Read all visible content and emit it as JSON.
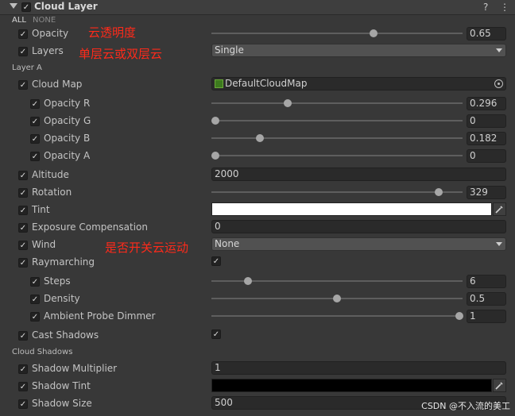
{
  "component": {
    "title": "Cloud Layer",
    "checked": true
  },
  "header_icons": {
    "help": "?",
    "settings": "⋮"
  },
  "filter": {
    "all": "ALL",
    "none": "NONE"
  },
  "properties": {
    "opacity": {
      "label": "Opacity",
      "value": "0.65",
      "slider": 0.65
    },
    "layers": {
      "label": "Layers",
      "value": "Single"
    },
    "layer_a_section": "Layer A",
    "cloud_map": {
      "label": "Cloud Map",
      "value": "DefaultCloudMap",
      "icon": "texture-thumbnail-icon"
    },
    "opacity_r": {
      "label": "Opacity R",
      "value": "0.296",
      "slider": 0.296
    },
    "opacity_g": {
      "label": "Opacity G",
      "value": "0",
      "slider": 0
    },
    "opacity_b": {
      "label": "Opacity B",
      "value": "0.182",
      "slider": 0.182
    },
    "opacity_a": {
      "label": "Opacity A",
      "value": "0",
      "slider": 0
    },
    "altitude": {
      "label": "Altitude",
      "value": "2000"
    },
    "rotation": {
      "label": "Rotation",
      "value": "329",
      "slider": 0.914
    },
    "tint": {
      "label": "Tint",
      "color": "#ffffff"
    },
    "exposure": {
      "label": "Exposure Compensation",
      "value": "0"
    },
    "wind": {
      "label": "Wind",
      "value": "None"
    },
    "raymarching": {
      "label": "Raymarching",
      "checked": true
    },
    "steps": {
      "label": "Steps",
      "value": "6",
      "slider": 0.15
    },
    "density": {
      "label": "Density",
      "value": "0.5",
      "slider": 0.5
    },
    "ambient_probe": {
      "label": "Ambient Probe Dimmer",
      "value": "1",
      "slider": 1
    },
    "cast_shadows": {
      "label": "Cast Shadows",
      "checked": true
    },
    "cloud_shadows_section": "Cloud Shadows",
    "shadow_multiplier": {
      "label": "Shadow Multiplier",
      "value": "1"
    },
    "shadow_tint": {
      "label": "Shadow Tint",
      "color": "#000000"
    },
    "shadow_size": {
      "label": "Shadow Size",
      "value": "500"
    }
  },
  "annotations": {
    "opacity_note": "云透明度",
    "layers_note": "单层云或双层云",
    "wind_note": "是否开关云运动"
  },
  "watermark": "CSDN @不入流的美工",
  "colors": {
    "annotation": "#ff2a1a",
    "background": "#383838"
  }
}
